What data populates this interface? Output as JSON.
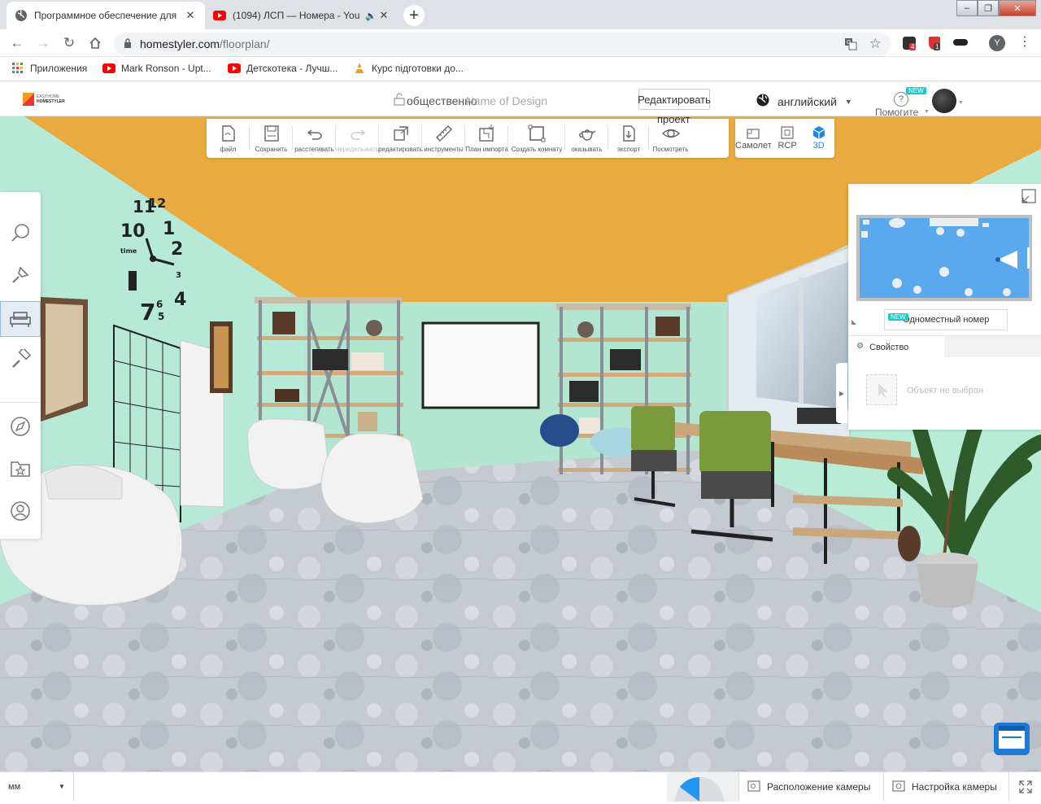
{
  "browser": {
    "tabs": [
      {
        "title": "Программное обеспечение для",
        "icon": "globe-icon",
        "active": true
      },
      {
        "title": "(1094) ЛСП — Номера - You",
        "icon": "youtube-icon",
        "active": false
      }
    ],
    "new_tab": "+",
    "window_controls": {
      "minimize": "–",
      "maximize": "❐",
      "close": "✕"
    },
    "url_host": "homestyler.com",
    "url_path": "/floorplan/",
    "profile_letter": "Y",
    "extension_badges": [
      "4",
      "1"
    ]
  },
  "bookmarks": [
    {
      "label": "Приложения",
      "icon": "apps-grid-icon"
    },
    {
      "label": "Mark Ronson - Upt...",
      "icon": "youtube-icon"
    },
    {
      "label": "Детскотека - Лучш...",
      "icon": "youtube-icon"
    },
    {
      "label": "Курс підготовки до...",
      "icon": "cone-icon"
    }
  ],
  "app_header": {
    "logo_top": "EASYHOME",
    "logo_bottom": "HOMESTYLER",
    "visibility": "общественно",
    "design_name_placeholder": "Name of Design",
    "edit_project_label_1": "Редактировать",
    "edit_project_label_2": "проект",
    "language": "английский",
    "help_label": "Помогите",
    "help_badge": "NEW"
  },
  "main_tools": [
    {
      "label": "файл",
      "icon": "file-icon",
      "enabled": true
    },
    {
      "label": "Сохранить",
      "icon": "save-icon",
      "enabled": true
    },
    {
      "label": "расстегивать",
      "icon": "undo-icon",
      "enabled": true
    },
    {
      "label": "переделывать",
      "icon": "redo-icon",
      "enabled": false
    },
    {
      "label": "редактировать",
      "icon": "edit-icon",
      "enabled": true
    },
    {
      "label": "инструменты",
      "icon": "ruler-icon",
      "enabled": true
    },
    {
      "label": "План импорта",
      "icon": "import-plan-icon",
      "enabled": true
    },
    {
      "label": "Создать комнату",
      "icon": "create-room-icon",
      "enabled": true
    },
    {
      "label": "оказывать",
      "icon": "teapot-icon",
      "enabled": true
    },
    {
      "label": "экспорт",
      "icon": "export-icon",
      "enabled": true
    },
    {
      "label": "Посмотреть",
      "icon": "eye-icon",
      "enabled": true
    }
  ],
  "view_tools": [
    {
      "label": "Самолет",
      "icon": "plane-icon",
      "active": false
    },
    {
      "label": "RCP",
      "icon": "rcp-icon",
      "active": false
    },
    {
      "label": "3D",
      "icon": "cube-icon",
      "active": true
    }
  ],
  "left_tools": [
    {
      "name": "search",
      "icon": "search-icon"
    },
    {
      "name": "build",
      "icon": "trowel-icon"
    },
    {
      "name": "furnish",
      "icon": "sofa-icon",
      "active": true
    },
    {
      "name": "paint",
      "icon": "paint-roller-icon"
    },
    {
      "name": "inspire",
      "icon": "compass-icon"
    },
    {
      "name": "favorites",
      "icon": "star-folder-icon"
    },
    {
      "name": "account",
      "icon": "user-icon"
    }
  ],
  "right_panel": {
    "room_badge": "NEW",
    "room_name": "Одноместный номер",
    "property_tab": "Свойство",
    "empty_message": "Объект не выбран"
  },
  "bottom_bar": {
    "unit": "мм",
    "camera_position": "Расположение камеры",
    "camera_settings": "Настройка камеры"
  },
  "clock_numbers": [
    "11",
    "12",
    "1",
    "2",
    "3",
    "4",
    "5",
    "6",
    "7",
    "10",
    "time"
  ],
  "colors": {
    "ceiling": "#e9aa3f",
    "wall": "#b4ebd5",
    "floor": "#c3c8cf",
    "accent": "#1e88e5",
    "new_badge": "#1ec8c8"
  }
}
